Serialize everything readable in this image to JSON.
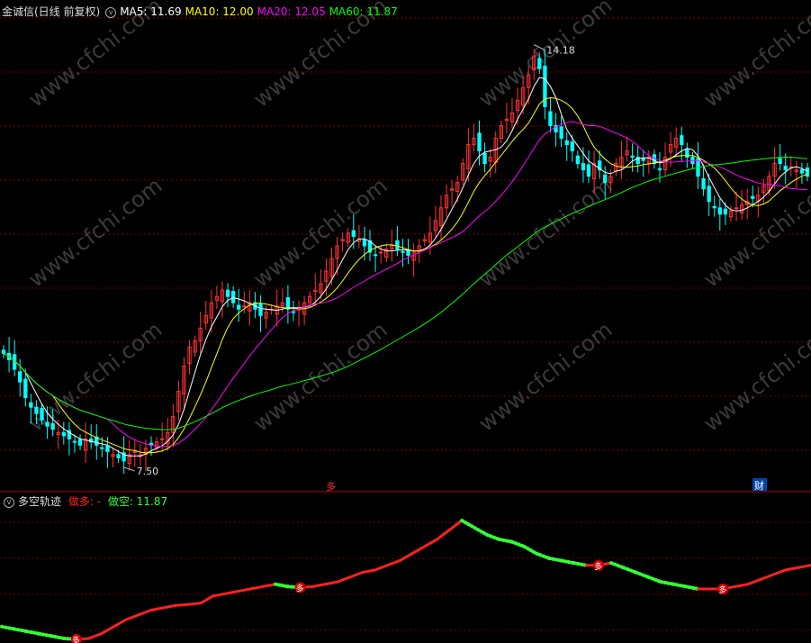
{
  "main_legend": {
    "title": "金诚信(日线 前复权)",
    "items": [
      {
        "label": "MA5: 11.69",
        "color": "#ffffff"
      },
      {
        "label": "MA10: 12.00",
        "color": "#ffff00"
      },
      {
        "label": "MA20: 12.05",
        "color": "#ff00ff"
      },
      {
        "label": "MA60: 11.87",
        "color": "#00ff00"
      }
    ]
  },
  "indicator_legend": {
    "title": "多空轨迹",
    "long_label": "做多: -",
    "short_label": "做空: 11.87",
    "long_color": "#ff2020",
    "short_color": "#33ff33"
  },
  "markers": {
    "bottom_char": "多",
    "event_char": "财",
    "high_label": "14.18",
    "low_label": "7.50"
  },
  "watermark": "www.cfchi.com",
  "colors": {
    "up": "#ff3333",
    "down": "#00ffff",
    "grid": "#7a0000"
  },
  "chart_data": [
    {
      "type": "candlestick",
      "ylim": [
        7.2,
        14.6
      ],
      "annotations": [
        {
          "label": "14.18",
          "value": 14.18
        },
        {
          "label": "7.50",
          "value": 7.5
        }
      ],
      "closes": [
        9.3,
        9.2,
        9.05,
        8.85,
        8.6,
        8.45,
        8.35,
        8.25,
        8.15,
        8.1,
        8.05,
        8.0,
        7.95,
        7.9,
        7.85,
        7.95,
        7.9,
        7.85,
        7.8,
        7.75,
        7.7,
        7.65,
        7.6,
        7.7,
        7.75,
        7.7,
        7.8,
        7.85,
        7.9,
        7.95,
        8.05,
        8.3,
        8.7,
        9.1,
        9.4,
        9.5,
        9.7,
        9.9,
        10.1,
        10.2,
        10.3,
        10.2,
        10.1,
        10.0,
        10.05,
        10.1,
        10.0,
        9.9,
        9.95,
        10.0,
        10.05,
        10.1,
        10.0,
        9.95,
        10.0,
        10.1,
        10.2,
        10.3,
        10.4,
        10.6,
        10.8,
        11.0,
        11.1,
        11.2,
        11.15,
        11.1,
        11.0,
        10.9,
        10.85,
        10.9,
        10.95,
        11.0,
        10.95,
        10.9,
        10.85,
        10.9,
        11.0,
        11.1,
        11.2,
        11.4,
        11.6,
        11.8,
        11.9,
        12.0,
        12.3,
        12.6,
        12.7,
        12.5,
        12.3,
        12.4,
        12.7,
        12.9,
        13.0,
        13.1,
        13.3,
        13.5,
        13.7,
        14.0,
        13.8,
        13.2,
        12.9,
        12.8,
        12.7,
        12.6,
        12.5,
        12.3,
        12.2,
        12.1,
        12.3,
        12.2,
        12.0,
        12.1,
        12.3,
        12.4,
        12.5,
        12.4,
        12.3,
        12.35,
        12.4,
        12.3,
        12.2,
        12.4,
        12.6,
        12.7,
        12.6,
        12.4,
        12.3,
        12.1,
        11.9,
        11.7,
        11.6,
        11.5,
        11.5,
        11.55,
        11.6,
        11.65,
        11.7,
        11.75,
        11.8,
        11.95,
        12.1,
        12.3,
        12.3,
        12.2,
        12.25,
        12.2,
        12.15,
        12.1
      ]
    },
    {
      "type": "line",
      "name": "多空轨迹",
      "values": [
        8.15,
        8.1,
        8.05,
        8.0,
        7.95,
        7.9,
        7.88,
        7.9,
        8.0,
        8.15,
        8.3,
        8.4,
        8.5,
        8.55,
        8.6,
        8.62,
        8.65,
        8.8,
        8.85,
        8.9,
        8.95,
        9.0,
        9.05,
        9.0,
        8.98,
        9.0,
        9.05,
        9.1,
        9.2,
        9.3,
        9.35,
        9.45,
        9.55,
        9.7,
        9.85,
        10.0,
        10.2,
        10.4,
        10.25,
        10.1,
        10.0,
        9.95,
        9.85,
        9.7,
        9.6,
        9.55,
        9.5,
        9.45,
        9.45,
        9.5,
        9.4,
        9.3,
        9.2,
        9.1,
        9.05,
        9.0,
        8.95,
        8.95,
        8.95,
        9.0,
        9.05,
        9.15,
        9.25,
        9.35,
        9.4,
        9.45
      ]
    }
  ]
}
